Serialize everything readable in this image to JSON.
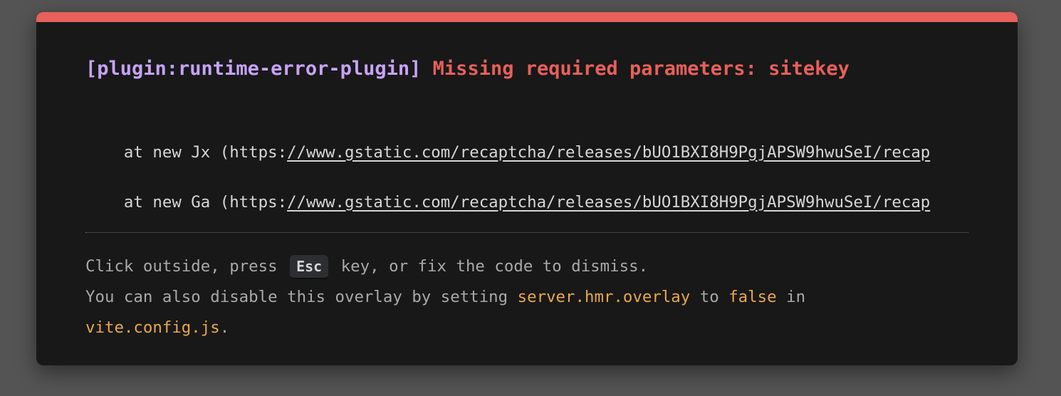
{
  "error": {
    "plugin": "[plugin:runtime-error-plugin]",
    "message": "Missing required parameters: sitekey"
  },
  "stack": [
    {
      "prefix": "    at new Jx (https:",
      "url": "//www.gstatic.com/recaptcha/releases/bUO1BXI8H9PgjAPSW9hwuSeI/recap"
    },
    {
      "prefix": "    at new Ga (https:",
      "url": "//www.gstatic.com/recaptcha/releases/bUO1BXI8H9PgjAPSW9hwuSeI/recap"
    }
  ],
  "tip": {
    "line1_before": "Click outside, press ",
    "key": "Esc",
    "line1_after": " key, or fix the code to dismiss.",
    "line2_before": "You can also disable this overlay by setting ",
    "setting": "server.hmr.overlay",
    "line2_mid": " to ",
    "value": "false",
    "line2_after": " in",
    "config_file": "vite.config.js",
    "line3_after": "."
  },
  "colors": {
    "accent": "#e8605a",
    "plugin": "#c6a3f7",
    "code": "#e8a84a",
    "background": "#181818",
    "backdrop": "#545454"
  }
}
